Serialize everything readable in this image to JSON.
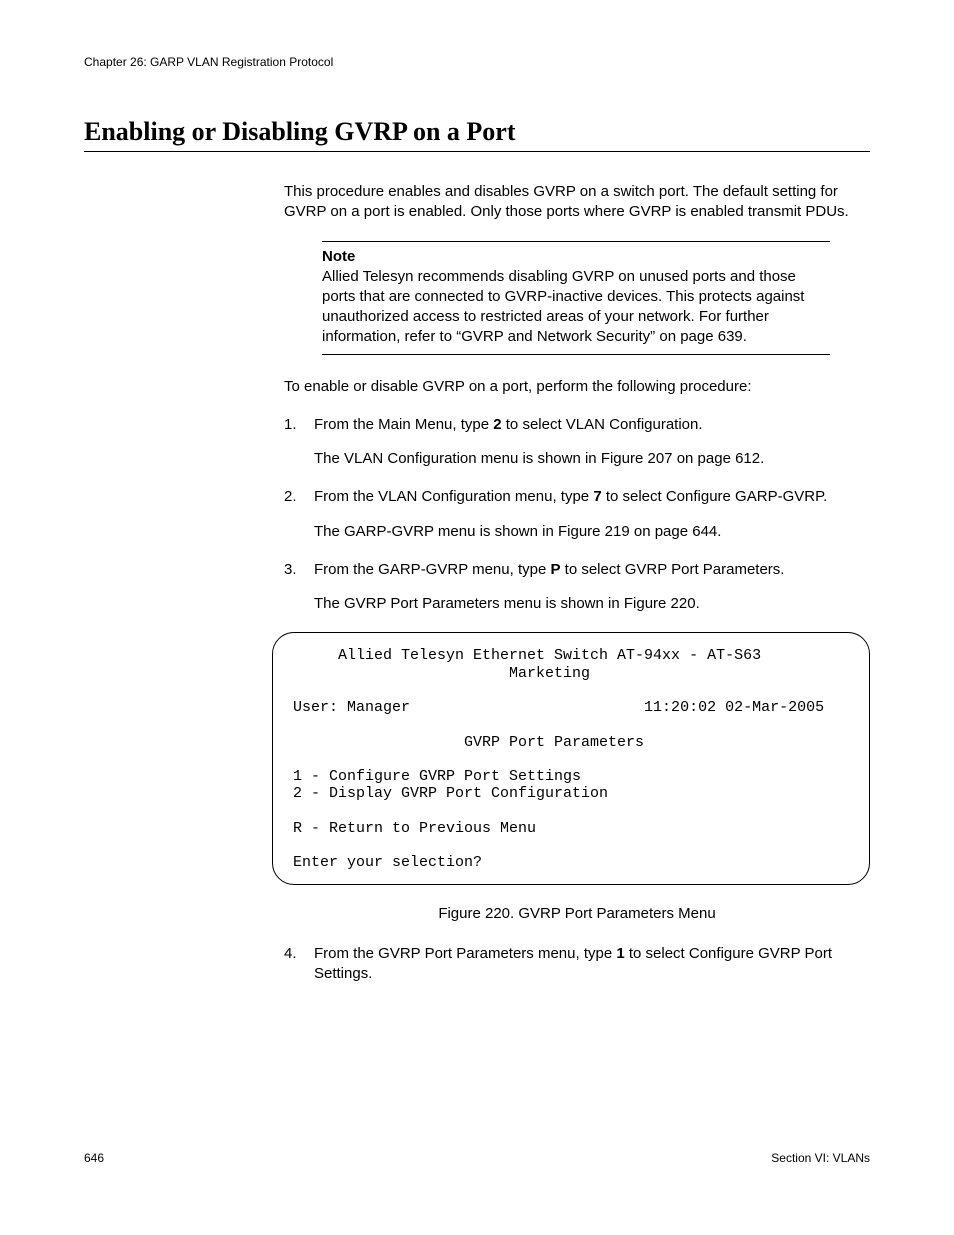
{
  "header": {
    "chapter": "Chapter 26: GARP VLAN Registration Protocol"
  },
  "title": "Enabling or Disabling GVRP on a Port",
  "intro": "This procedure enables and disables GVRP on a switch port. The default setting for GVRP on a port is enabled. Only those ports where GVRP is enabled transmit PDUs.",
  "note": {
    "label": "Note",
    "text": "Allied Telesyn recommends disabling GVRP on unused ports and those ports that are connected to GVRP-inactive devices. This protects against unauthorized access to restricted areas of your network. For further information, refer to “GVRP and Network Security” on page 639."
  },
  "lead": "To enable or disable GVRP on a port, perform the following procedure:",
  "steps": {
    "s1_num": "1.",
    "s1_a": "From the Main Menu, type ",
    "s1_b": "2",
    "s1_c": " to select VLAN Configuration.",
    "s1_sub": "The VLAN Configuration menu is shown in Figure 207 on page 612.",
    "s2_num": "2.",
    "s2_a": "From the VLAN Configuration menu, type ",
    "s2_b": "7",
    "s2_c": " to select Configure GARP-GVRP.",
    "s2_sub": "The GARP-GVRP menu is shown in Figure 219 on page 644.",
    "s3_num": "3.",
    "s3_a": "From the GARP-GVRP menu, type ",
    "s3_b": "P",
    "s3_c": " to select GVRP Port Parameters.",
    "s3_sub": "The GVRP Port Parameters menu is shown in Figure 220.",
    "s4_num": "4.",
    "s4_a": "From the GVRP Port Parameters menu, type ",
    "s4_b": "1",
    "s4_c": " to select Configure GVRP Port Settings."
  },
  "terminal": "     Allied Telesyn Ethernet Switch AT-94xx - AT-S63\n                        Marketing\n\nUser: Manager                          11:20:02 02-Mar-2005\n\n                   GVRP Port Parameters\n\n1 - Configure GVRP Port Settings\n2 - Display GVRP Port Configuration\n\nR - Return to Previous Menu\n\nEnter your selection?",
  "figcap": "Figure 220. GVRP Port Parameters Menu",
  "footer": {
    "page": "646",
    "section": "Section VI: VLANs"
  }
}
